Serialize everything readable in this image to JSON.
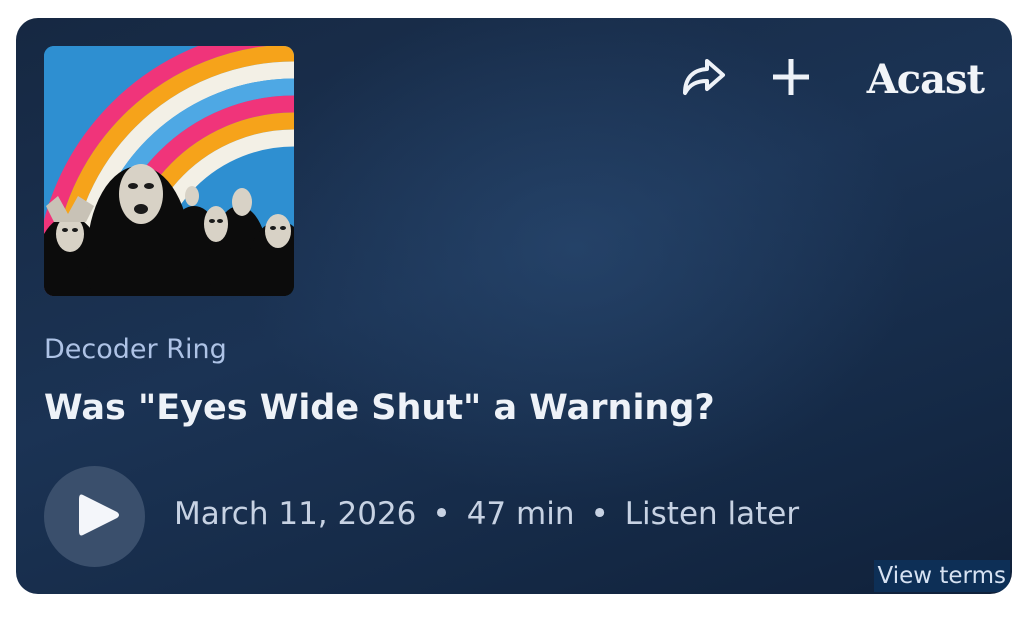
{
  "embed": {
    "brand": "Acast",
    "show_name": "Decoder Ring",
    "episode_title": "Was \"Eyes Wide Shut\" a Warning?",
    "date": "March 11, 2026",
    "duration": "47 min",
    "separator": "•",
    "listen_later": "Listen later",
    "view_terms": "View terms",
    "artwork": "podcast-cover-rainbow-masked-figures",
    "icons": {
      "share": "share-arrow-icon",
      "add": "plus-icon",
      "play": "play-icon"
    },
    "colors": {
      "card_background": "#1b3354",
      "show_name": "#aec3e6",
      "title": "#eef2f8",
      "play_button": "#3a4f6c"
    }
  }
}
